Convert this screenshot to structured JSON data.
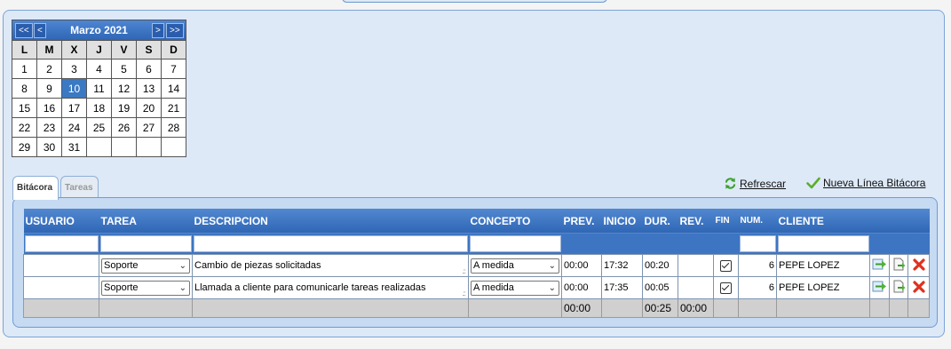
{
  "calendar": {
    "prev_year_label": "<<",
    "prev_month_label": "<",
    "month_title": "Marzo 2021",
    "next_month_label": ">",
    "next_year_label": ">>",
    "weekday_headers": [
      "L",
      "M",
      "X",
      "J",
      "V",
      "S",
      "D"
    ],
    "weeks": [
      [
        "1",
        "2",
        "3",
        "4",
        "5",
        "6",
        "7"
      ],
      [
        "8",
        "9",
        "10",
        "11",
        "12",
        "13",
        "14"
      ],
      [
        "15",
        "16",
        "17",
        "18",
        "19",
        "20",
        "21"
      ],
      [
        "22",
        "23",
        "24",
        "25",
        "26",
        "27",
        "28"
      ],
      [
        "29",
        "30",
        "31",
        "",
        "",
        "",
        ""
      ]
    ],
    "selected_day": "10"
  },
  "tabs": [
    {
      "label": "Bitácora",
      "active": true
    },
    {
      "label": "Tareas",
      "active": false
    }
  ],
  "actions": {
    "refresh_label": "Refrescar",
    "refresh_icon": "refresh-icon",
    "new_line_label": "Nueva Línea Bitácora",
    "new_line_icon": "checkmark-icon"
  },
  "grid": {
    "columns": [
      "USUARIO",
      "TAREA",
      "DESCRIPCION",
      "CONCEPTO",
      "PREV.",
      "INICIO",
      "DUR.",
      "REV.",
      "FIN",
      "NUM.",
      "CLIENTE"
    ],
    "rows": [
      {
        "usuario": "",
        "tarea": "Soporte",
        "descripcion": "Cambio de piezas solicitadas",
        "concepto": "A medida",
        "prev": "00:00",
        "inicio": "17:32",
        "dur": "00:20",
        "rev": "",
        "fin": true,
        "num": "6",
        "cliente": "PEPE LOPEZ"
      },
      {
        "usuario": "",
        "tarea": "Soporte",
        "descripcion": "Llamada a cliente para comunicarle tareas realizadas",
        "concepto": "A medida",
        "prev": "00:00",
        "inicio": "17:35",
        "dur": "00:05",
        "rev": "",
        "fin": true,
        "num": "6",
        "cliente": "PEPE LOPEZ"
      }
    ],
    "totals": {
      "prev": "00:00",
      "dur": "00:25",
      "rev": "00:00"
    },
    "row_action_icons": [
      "move-line-icon",
      "export-document-icon",
      "delete-icon"
    ]
  }
}
